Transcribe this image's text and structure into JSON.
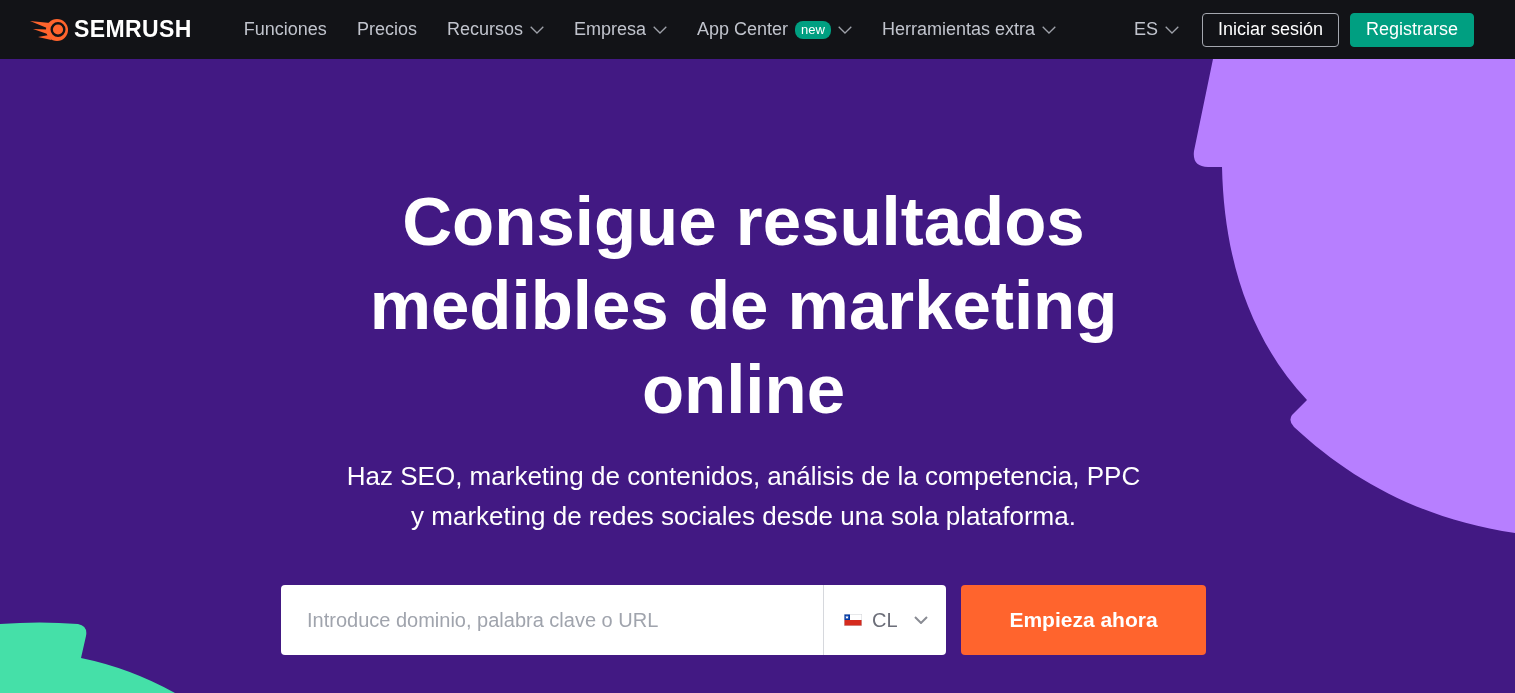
{
  "nav": {
    "logo": "SEMRUSH",
    "items": [
      {
        "label": "Funciones",
        "dropdown": false
      },
      {
        "label": "Precios",
        "dropdown": false
      },
      {
        "label": "Recursos",
        "dropdown": true
      },
      {
        "label": "Empresa",
        "dropdown": true
      },
      {
        "label": "App Center",
        "badge": "new",
        "dropdown": true
      },
      {
        "label": "Herramientas extra",
        "dropdown": true
      }
    ],
    "language": {
      "label": "ES",
      "dropdown": true
    },
    "buttons": [
      {
        "label": "Iniciar sesión",
        "kind": "outline"
      },
      {
        "label": "Registrarse",
        "kind": "primary"
      }
    ]
  },
  "hero": {
    "title": "Consigue resultados medibles de marketing online",
    "subtitle": "Haz SEO, marketing de contenidos, análisis de la competencia, PPC y marketing de redes sociales desde una sola plataforma.",
    "search": {
      "placeholder": "Introduce dominio, palabra clave o URL",
      "country": {
        "code": "CL",
        "dropdown": true
      },
      "button": "Empieza ahora"
    }
  }
}
